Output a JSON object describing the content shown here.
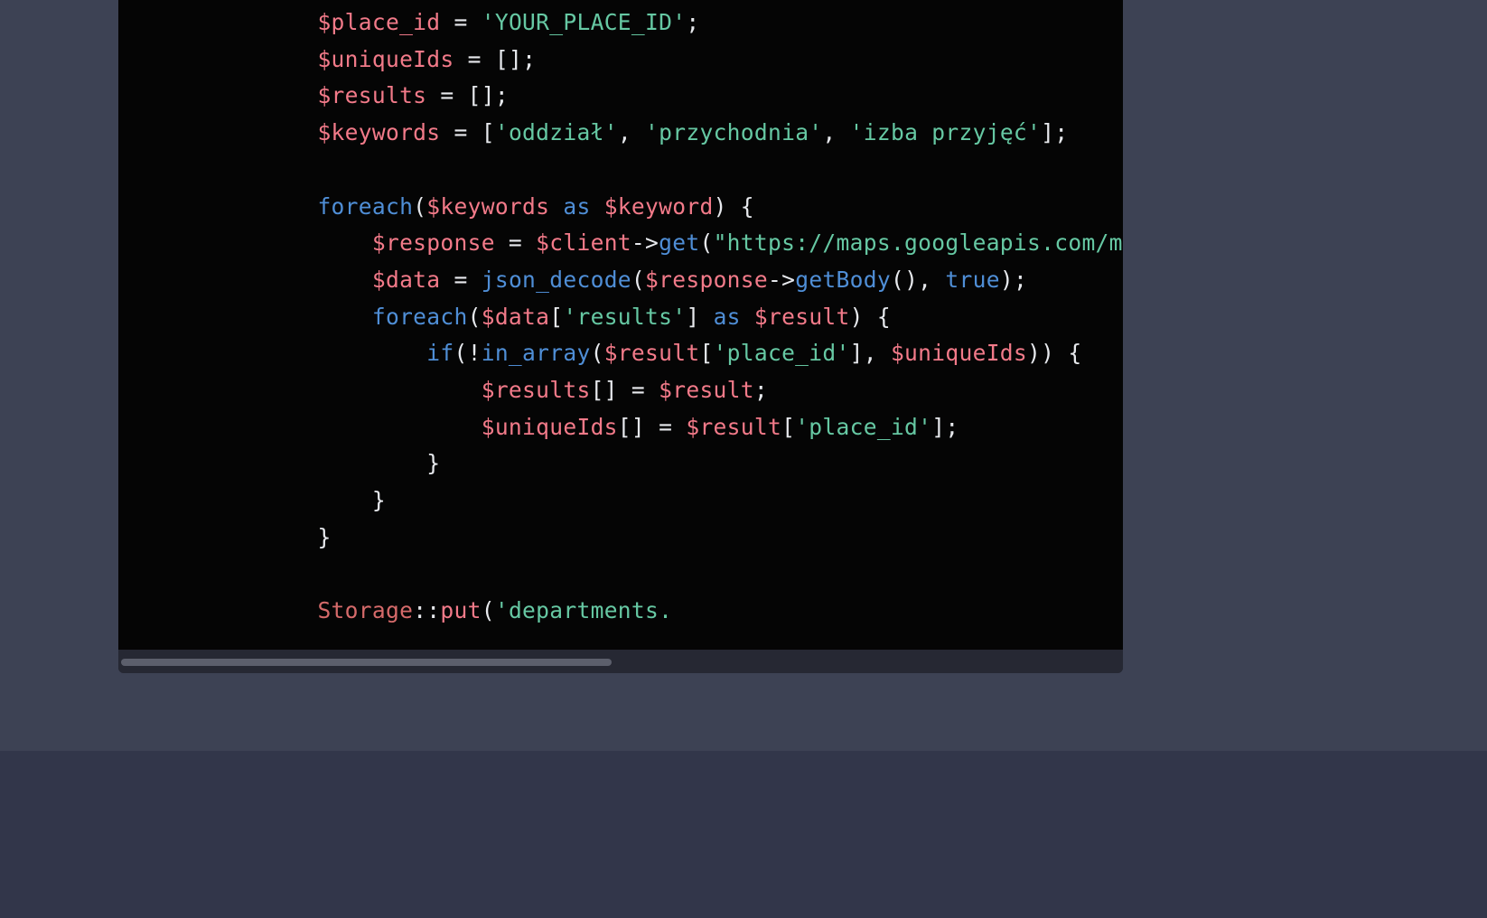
{
  "code": {
    "indent1": "    ",
    "indent2": "        ",
    "indent3": "            ",
    "indent4": "                ",
    "indent5": "                    ",
    "l1": {
      "v": "$place_id",
      "eq": " = ",
      "s": "'YOUR_PLACE_ID'",
      "end": ";"
    },
    "l2": {
      "v": "$uniqueIds",
      "eq": " = ",
      "b": "[]",
      "end": ";"
    },
    "l3": {
      "v": "$results",
      "eq": " = ",
      "b": "[]",
      "end": ";"
    },
    "l4": {
      "v": "$keywords",
      "eq": " = [",
      "s1": "'oddział'",
      "c1": ", ",
      "s2": "'przychodnia'",
      "c2": ", ",
      "s3": "'izba przyjęć'",
      "end": "];"
    },
    "l5": {
      "kw": "foreach",
      "open": "(",
      "v1": "$keywords",
      "as": " as ",
      "v2": "$keyword",
      "close": ") {"
    },
    "l6": {
      "v1": "$response",
      "eq": " = ",
      "v2": "$client",
      "arr": "->",
      "fn": "get",
      "open": "(",
      "s": "\"https://maps.googleapis.com/maps/api/p"
    },
    "l7": {
      "v1": "$data",
      "eq": " = ",
      "fn": "json_decode",
      "open": "(",
      "v2": "$response",
      "arr": "->",
      "fn2": "getBody",
      "paren": "(), ",
      "b": "true",
      "close": ");"
    },
    "l8": {
      "kw": "foreach",
      "open": "(",
      "v1": "$data",
      "br": "[",
      "s": "'results'",
      "brc": "] ",
      "as": "as ",
      "v2": "$result",
      "close": ") {"
    },
    "l9": {
      "kw": "if",
      "open": "(!",
      "fn": "in_array",
      "po": "(",
      "v1": "$result",
      "br": "[",
      "s": "'place_id'",
      "brc": "], ",
      "v2": "$uniqueIds",
      "close": ")) {"
    },
    "l10": {
      "v1": "$results",
      "br": "[] = ",
      "v2": "$result",
      "end": ";"
    },
    "l11": {
      "v1": "$uniqueIds",
      "br": "[] = ",
      "v2": "$result",
      "br2": "[",
      "s": "'place_id'",
      "brc": "];"
    },
    "l12": {
      "c": "}"
    },
    "l13": {
      "c": "}"
    },
    "l14": {
      "c": "}"
    },
    "l15": {
      "cls": "Storage",
      "sc": "::",
      "fn": "put",
      "open": "(",
      "s": "'departments."
    }
  }
}
